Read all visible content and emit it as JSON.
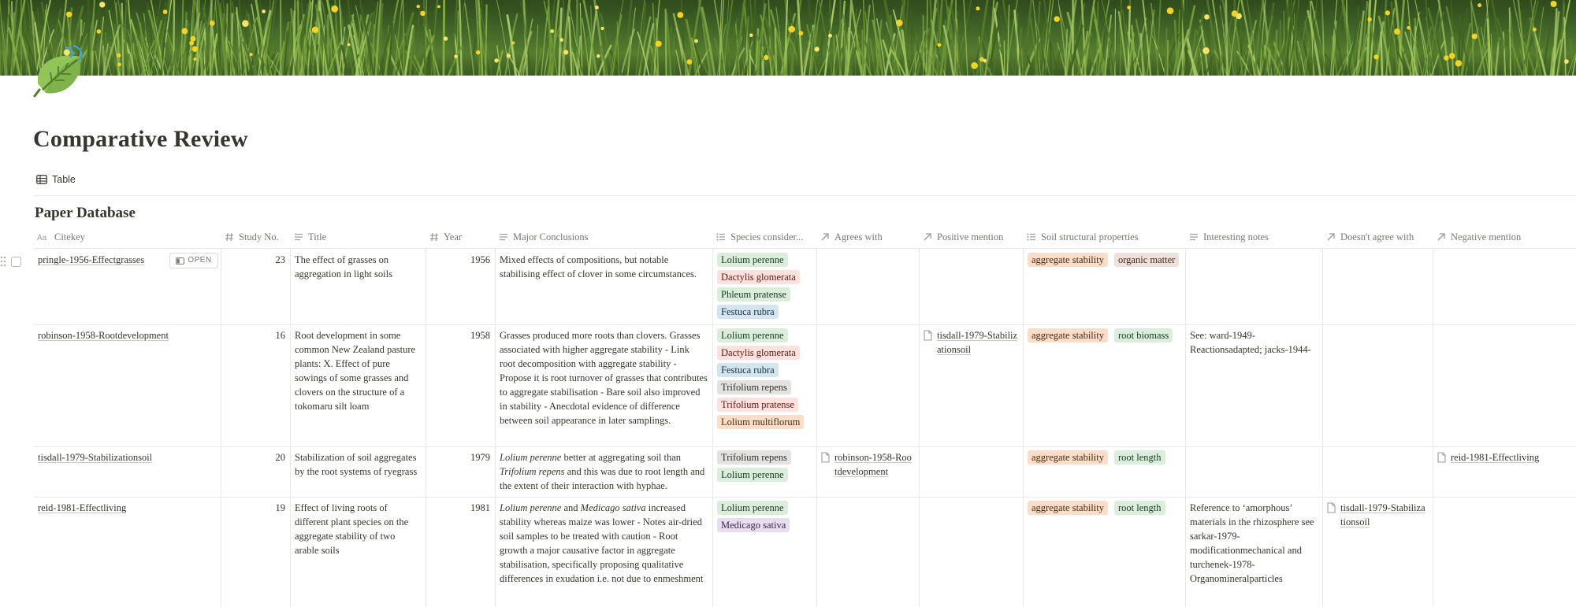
{
  "page": {
    "title": "Comparative Review",
    "view_tab": "Table",
    "database_title": "Paper Database",
    "open_label": "OPEN"
  },
  "columns": [
    {
      "icon": "title-text-icon",
      "label": "Citekey"
    },
    {
      "icon": "hash-icon",
      "label": "Study No."
    },
    {
      "icon": "text-lines-icon",
      "label": "Title"
    },
    {
      "icon": "hash-icon",
      "label": "Year"
    },
    {
      "icon": "text-lines-icon",
      "label": "Major Conclusions"
    },
    {
      "icon": "list-icon",
      "label": "Species consider..."
    },
    {
      "icon": "relation-arrow-icon",
      "label": "Agrees with"
    },
    {
      "icon": "relation-arrow-icon",
      "label": "Positive mention"
    },
    {
      "icon": "list-icon",
      "label": "Soil structural properties"
    },
    {
      "icon": "text-lines-icon",
      "label": "Interesting notes"
    },
    {
      "icon": "relation-arrow-icon",
      "label": "Doesn't agree with"
    },
    {
      "icon": "relation-arrow-icon",
      "label": "Negative mention"
    }
  ],
  "rows": [
    {
      "citekey": "pringle-1956-Effectgrasses",
      "study_no": "23",
      "title": "The effect of grasses on aggregation in light soils",
      "year": "1956",
      "conclusions": "Mixed effects of compositions, but notable stabilising effect of clover in some circumstances.",
      "species": [
        {
          "label": "Lolium perenne",
          "color": "green"
        },
        {
          "label": "Dactylis glomerata",
          "color": "red"
        },
        {
          "label": "Phleum pratense",
          "color": "green"
        },
        {
          "label": "Festuca rubra",
          "color": "blue"
        }
      ],
      "agrees_with": "",
      "positive_mention": "",
      "soil": [
        {
          "label": "aggregate stability",
          "color": "orange"
        },
        {
          "label": "organic matter",
          "color": "brown"
        }
      ],
      "notes": "",
      "disagrees_with": "",
      "negative_mention": ""
    },
    {
      "citekey": "robinson-1958-Rootdevelopment",
      "study_no": "16",
      "title": "Root development in some common New Zealand pasture plants: X. Effect of pure sowings of some grasses and clovers on the structure of a tokomaru silt loam",
      "year": "1958",
      "conclusions": "Grasses produced more roots than clovers. Grasses associated with higher aggregate stability - Link root decomposition with aggregate stability - Propose it is root turnover of grasses that contributes to aggregate stabilisation - Bare soil also improved in stability - Anecdotal evidence of difference between soil appearance in later samplings.",
      "species": [
        {
          "label": "Lolium perenne",
          "color": "green"
        },
        {
          "label": "Dactylis glomerata",
          "color": "red"
        },
        {
          "label": "Festuca rubra",
          "color": "blue"
        },
        {
          "label": "Trifolium repens",
          "color": "gray"
        },
        {
          "label": "Trifolium pratense",
          "color": "red"
        },
        {
          "label": "Lolium multiflorum",
          "color": "orange"
        }
      ],
      "agrees_with": "",
      "positive_mention": "tisdall-1979-Stabilizationsoil",
      "soil": [
        {
          "label": "aggregate stability",
          "color": "orange"
        },
        {
          "label": "root biomass",
          "color": "green"
        }
      ],
      "notes": "See: ward-1949-Reactionsadapted; jacks-1944-",
      "disagrees_with": "",
      "negative_mention": ""
    },
    {
      "citekey": "tisdall-1979-Stabilizationsoil",
      "study_no": "20",
      "title": "Stabilization of soil aggregates by the root systems of ryegrass",
      "year": "1979",
      "conclusions_parts": {
        "a": "Lolium perenne",
        "b": " better at aggregating soil than ",
        "c": "Trifolium repens",
        "d": " and this was due to root length and the extent of their interaction with hyphae."
      },
      "species": [
        {
          "label": "Trifolium repens",
          "color": "gray"
        },
        {
          "label": "Lolium perenne",
          "color": "green"
        }
      ],
      "agrees_with": "robinson-1958-Rootdevelopment",
      "positive_mention": "",
      "soil": [
        {
          "label": "aggregate stability",
          "color": "orange"
        },
        {
          "label": "root length",
          "color": "green"
        }
      ],
      "notes": "",
      "disagrees_with": "",
      "negative_mention": "reid-1981-Effectliving"
    },
    {
      "citekey": "reid-1981-Effectliving",
      "study_no": "19",
      "title": "Effect of living roots of different plant species on the aggregate stability of two arable soils",
      "year": "1981",
      "conclusions_parts": {
        "a": "Lolium perenne",
        "b": " and ",
        "c": "Medicago sativa",
        "d": " increased stability whereas maize was lower - Notes air-dried soil samples to be treated with caution - Root growth a major causative factor in  aggregate stabilisation, specifically proposing qualitative differences in exudation i.e. not due to enmeshment"
      },
      "species": [
        {
          "label": "Lolium perenne",
          "color": "green"
        },
        {
          "label": "Medicago sativa",
          "color": "purple"
        }
      ],
      "agrees_with": "",
      "positive_mention": "",
      "soil": [
        {
          "label": "aggregate stability",
          "color": "orange"
        },
        {
          "label": "root length",
          "color": "green"
        }
      ],
      "notes": "Reference to ‘amorphous’ materials in the rhizosphere see sarkar-1979-modificationmechanical and turchenek-1978-Organomineralparticles",
      "disagrees_with": "tisdall-1979-Stabilizationsoil",
      "negative_mention": ""
    }
  ]
}
